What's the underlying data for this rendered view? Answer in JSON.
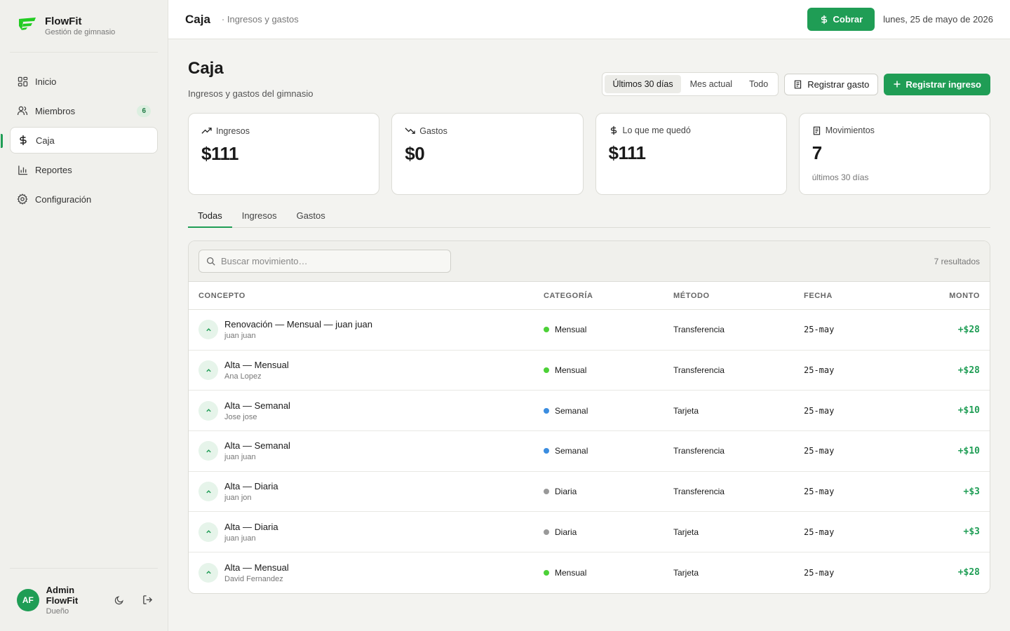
{
  "brand": {
    "name": "FlowFit",
    "subtitle": "Gestión de gimnasio",
    "color": "#22cc22"
  },
  "sidebar": {
    "items": [
      {
        "label": "Inicio",
        "icon": "dashboard-icon"
      },
      {
        "label": "Miembros",
        "icon": "users-icon",
        "badge": "6"
      },
      {
        "label": "Caja",
        "icon": "dollar-icon",
        "active": true
      },
      {
        "label": "Reportes",
        "icon": "bar-chart-icon"
      },
      {
        "label": "Configuración",
        "icon": "gear-icon"
      }
    ]
  },
  "user": {
    "initials": "AF",
    "name": "Admin FlowFit",
    "role": "Dueño"
  },
  "topbar": {
    "title": "Caja",
    "subtitle": "· Ingresos y gastos",
    "cobrar_label": "Cobrar",
    "date": "lunes, 25 de mayo de 2026"
  },
  "page": {
    "title": "Caja",
    "description": "Ingresos y gastos del gimnasio",
    "ranges": [
      "Últimos 30 días",
      "Mes actual",
      "Todo"
    ],
    "active_range": "Últimos 30 días",
    "register_expense_label": "Registrar gasto",
    "register_income_label": "Registrar ingreso"
  },
  "stats": [
    {
      "label": "Ingresos",
      "value": "$111",
      "note": ""
    },
    {
      "label": "Gastos",
      "value": "$0",
      "note": ""
    },
    {
      "label": "Lo que me quedó",
      "value": "$111",
      "note": ""
    },
    {
      "label": "Movimientos",
      "value": "7",
      "note": "últimos 30 días"
    }
  ],
  "tabs": [
    "Todas",
    "Ingresos",
    "Gastos"
  ],
  "table": {
    "search_placeholder": "Buscar movimiento…",
    "results": "7 resultados",
    "columns": {
      "concept": "CONCEPTO",
      "category": "CATEGORÍA",
      "method": "MÉTODO",
      "date": "FECHA",
      "amount": "MONTO"
    },
    "category_colors": {
      "Mensual": "#4cd137",
      "Semanal": "#3b8de0",
      "Diaria": "#999999"
    },
    "rows": [
      {
        "title": "Renovación — Mensual — juan juan",
        "member": "juan juan",
        "category": "Mensual",
        "method": "Transferencia",
        "date": "25-may",
        "amount": "+$28"
      },
      {
        "title": "Alta — Mensual",
        "member": "Ana Lopez",
        "category": "Mensual",
        "method": "Transferencia",
        "date": "25-may",
        "amount": "+$28"
      },
      {
        "title": "Alta — Semanal",
        "member": "Jose jose",
        "category": "Semanal",
        "method": "Tarjeta",
        "date": "25-may",
        "amount": "+$10"
      },
      {
        "title": "Alta — Semanal",
        "member": "juan juan",
        "category": "Semanal",
        "method": "Transferencia",
        "date": "25-may",
        "amount": "+$10"
      },
      {
        "title": "Alta — Diaria",
        "member": "juan jon",
        "category": "Diaria",
        "method": "Transferencia",
        "date": "25-may",
        "amount": "+$3"
      },
      {
        "title": "Alta — Diaria",
        "member": "juan juan",
        "category": "Diaria",
        "method": "Tarjeta",
        "date": "25-may",
        "amount": "+$3"
      },
      {
        "title": "Alta — Mensual",
        "member": "David Fernandez",
        "category": "Mensual",
        "method": "Tarjeta",
        "date": "25-may",
        "amount": "+$28"
      }
    ]
  },
  "colors": {
    "accent": "#1f9d55",
    "income": "#1f9d55"
  }
}
